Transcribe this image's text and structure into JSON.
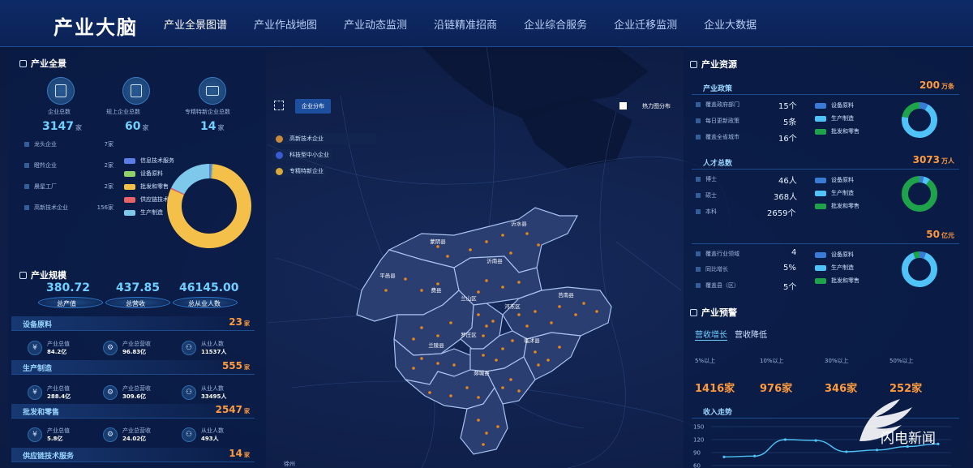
{
  "app": {
    "title": "产业大脑"
  },
  "nav": [
    "产业全景图谱",
    "产业作战地图",
    "产业动态监测",
    "沿链精准招商",
    "企业综合服务",
    "企业迁移监测",
    "企业大数据"
  ],
  "left": {
    "overview": {
      "title": "产业全景",
      "stats": [
        {
          "label": "企业总数",
          "value": "3147",
          "unit": "家"
        },
        {
          "label": "规上企业总数",
          "value": "60",
          "unit": "家"
        },
        {
          "label": "专精特新企业总数",
          "value": "14",
          "unit": "家"
        }
      ],
      "list": [
        {
          "label": "龙头企业",
          "value": "7家"
        },
        {
          "label": "瞪羚企业",
          "value": "2家"
        },
        {
          "label": "晨星工厂",
          "value": "2家"
        },
        {
          "label": "高新技术企业",
          "value": "156家"
        }
      ],
      "legend": [
        {
          "label": "信息技术服务",
          "color": "#5b7ee5"
        },
        {
          "label": "设备原料",
          "color": "#8fd16a"
        },
        {
          "label": "批发和零售",
          "color": "#f5c04a"
        },
        {
          "label": "供应链技术服务",
          "color": "#e8626a"
        },
        {
          "label": "生产制造",
          "color": "#7ec8ec"
        }
      ],
      "donut": [
        {
          "name": "信息技术服务",
          "value": 1,
          "color": "#5b7ee5"
        },
        {
          "name": "设备原料",
          "value": 0.5,
          "color": "#8fd16a"
        },
        {
          "name": "批发和零售",
          "value": 80,
          "color": "#f5c04a"
        },
        {
          "name": "供应链技术服务",
          "value": 0.5,
          "color": "#e8626a"
        },
        {
          "name": "生产制造",
          "value": 18,
          "color": "#7ec8ec"
        }
      ]
    },
    "scale": {
      "title": "产业规模",
      "totals": [
        {
          "value": "380.72",
          "label": "总产值"
        },
        {
          "value": "437.85",
          "label": "总营收"
        },
        {
          "value": "46145.00",
          "label": "总从业人数"
        }
      ],
      "industries": [
        {
          "name": "设备原料",
          "count": "23",
          "unit": "家",
          "output": "84.2亿",
          "revenue": "96.83亿",
          "staff": "11537人"
        },
        {
          "name": "生产制造",
          "count": "555",
          "unit": "家",
          "output": "288.4亿",
          "revenue": "309.6亿",
          "staff": "33495人"
        },
        {
          "name": "批发和零售",
          "count": "2547",
          "unit": "家",
          "output": "5.8亿",
          "revenue": "24.02亿",
          "staff": "493人"
        },
        {
          "name": "供应链技术服务",
          "count": "14",
          "unit": "家"
        }
      ],
      "labels": {
        "output": "产业总值",
        "revenue": "产业总营收",
        "staff": "从业人数"
      }
    }
  },
  "map": {
    "toggle_label": "企业分布",
    "heat_label": "热力图分布",
    "legend": [
      {
        "label": "高新技术企业",
        "color": "#c98a3c"
      },
      {
        "label": "科技型中小企业",
        "color": "#3a5bd0"
      },
      {
        "label": "专精特新企业",
        "color": "#d8a838"
      }
    ],
    "districts": [
      "沂水县",
      "蒙阴县",
      "沂南县",
      "平邑县",
      "费县",
      "兰山区",
      "河东区",
      "莒南县",
      "罗庄区",
      "兰陵县",
      "临沭县",
      "郯城县"
    ],
    "bottom_label": "徐州"
  },
  "right": {
    "resource": {
      "title": "产业资源",
      "policy": {
        "title": "产业政策",
        "value": "200",
        "unit": "万条",
        "rows": [
          {
            "label": "覆盖政府部门",
            "value": "15个"
          },
          {
            "label": "每日更新政策",
            "value": "5条"
          },
          {
            "label": "覆盖全省城市",
            "value": "16个"
          }
        ],
        "legend": [
          {
            "label": "设备原料",
            "color": "#3a7bd5"
          },
          {
            "label": "生产制造",
            "color": "#4fc3f7"
          },
          {
            "label": "批发和零售",
            "color": "#1fa34a"
          }
        ],
        "donut": [
          {
            "name": "设备原料",
            "value": 8,
            "color": "#3a7bd5"
          },
          {
            "name": "生产制造",
            "value": 70,
            "color": "#4fc3f7"
          },
          {
            "name": "批发和零售",
            "value": 22,
            "color": "#1fa34a"
          }
        ]
      },
      "talent": {
        "title": "人才总数",
        "value": "3073",
        "unit": "万人",
        "rows": [
          {
            "label": "博士",
            "value": "46人"
          },
          {
            "label": "硕士",
            "value": "368人"
          },
          {
            "label": "本科",
            "value": "2659个"
          }
        ],
        "legend": [
          {
            "label": "设备原料",
            "color": "#3a7bd5"
          },
          {
            "label": "生产制造",
            "color": "#4fc3f7"
          },
          {
            "label": "批发和零售",
            "color": "#1fa34a"
          }
        ],
        "donut": [
          {
            "name": "设备原料",
            "value": 4,
            "color": "#3a7bd5"
          },
          {
            "name": "生产制造",
            "value": 6,
            "color": "#4fc3f7"
          },
          {
            "name": "批发和零售",
            "value": 90,
            "color": "#1fa34a"
          }
        ]
      },
      "fund": {
        "title": "",
        "value": "50",
        "unit": "亿元",
        "rows": [
          {
            "label": "覆盖行业领域",
            "value": "4"
          },
          {
            "label": "同比增长",
            "value": "5%"
          },
          {
            "label": "覆盖县（区）",
            "value": "5个"
          }
        ],
        "legend": [
          {
            "label": "设备原料",
            "color": "#3a7bd5"
          },
          {
            "label": "生产制造",
            "color": "#4fc3f7"
          },
          {
            "label": "批发和零售",
            "color": "#1fa34a"
          }
        ],
        "donut": [
          {
            "name": "设备原料",
            "value": 6,
            "color": "#3a7bd5"
          },
          {
            "name": "生产制造",
            "value": 88,
            "color": "#4fc3f7"
          },
          {
            "name": "批发和零售",
            "value": 6,
            "color": "#1fa34a"
          }
        ]
      }
    },
    "warning": {
      "title": "产业预警",
      "tabs": [
        "营收增长",
        "营收降低"
      ],
      "buckets": [
        {
          "label": "5%以上",
          "value": "1416家"
        },
        {
          "label": "10%以上",
          "value": "976家"
        },
        {
          "label": "30%以上",
          "value": "346家"
        },
        {
          "label": "50%以上",
          "value": "252家"
        }
      ],
      "trend_title": "收入走势"
    }
  },
  "watermark": "闪电新闻",
  "chart_data": {
    "type": "line",
    "title": "收入走势",
    "y_ticks": [
      "150",
      "120",
      "90",
      "60"
    ],
    "ylim": [
      60,
      150
    ],
    "values": [
      80,
      82,
      120,
      118,
      92,
      96,
      104,
      110
    ]
  }
}
